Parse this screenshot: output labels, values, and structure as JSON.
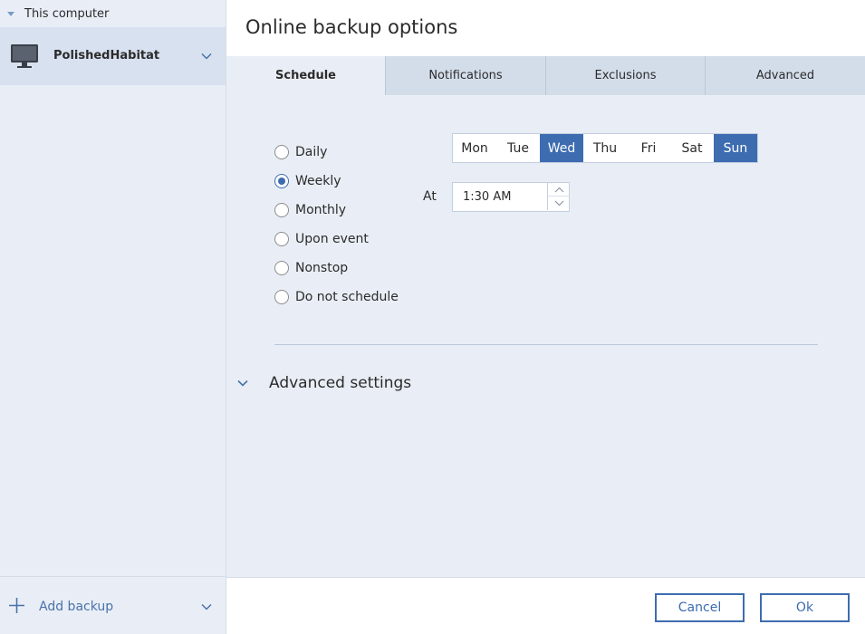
{
  "sidebar": {
    "header_label": "This computer",
    "items": [
      {
        "label": "PolishedHabitat",
        "icon": "monitor-icon"
      }
    ],
    "footer": {
      "label": "Add backup",
      "icon": "plus-icon"
    }
  },
  "main": {
    "title": "Online backup options",
    "tabs": [
      {
        "label": "Schedule",
        "active": true
      },
      {
        "label": "Notifications",
        "active": false
      },
      {
        "label": "Exclusions",
        "active": false
      },
      {
        "label": "Advanced",
        "active": false
      }
    ],
    "schedule": {
      "options": [
        {
          "label": "Daily",
          "checked": false
        },
        {
          "label": "Weekly",
          "checked": true
        },
        {
          "label": "Monthly",
          "checked": false
        },
        {
          "label": "Upon event",
          "checked": false
        },
        {
          "label": "Nonstop",
          "checked": false
        },
        {
          "label": "Do not schedule",
          "checked": false
        }
      ],
      "days": [
        {
          "label": "Mon",
          "selected": false
        },
        {
          "label": "Tue",
          "selected": false
        },
        {
          "label": "Wed",
          "selected": true
        },
        {
          "label": "Thu",
          "selected": false
        },
        {
          "label": "Fri",
          "selected": false
        },
        {
          "label": "Sat",
          "selected": false
        },
        {
          "label": "Sun",
          "selected": true
        }
      ],
      "at_label": "At",
      "time_value": "1:30 AM"
    },
    "advanced_settings_label": "Advanced settings"
  },
  "buttons": {
    "cancel": "Cancel",
    "ok": "Ok"
  },
  "colors": {
    "accent": "#3d6cb0",
    "sidebar_bg": "#e9eef6",
    "selected_item_bg": "#d7e1ef"
  }
}
